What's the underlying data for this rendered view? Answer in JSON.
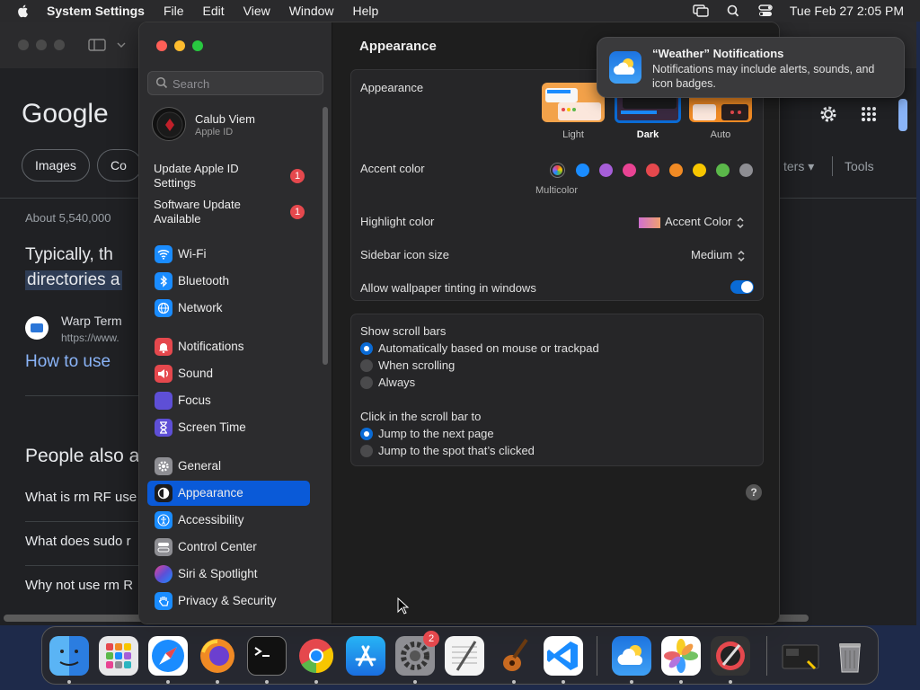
{
  "menubar": {
    "app_name": "System Settings",
    "items": [
      "File",
      "Edit",
      "View",
      "Window",
      "Help"
    ],
    "clock": "Tue Feb 27  2:05 PM"
  },
  "browser": {
    "logo": "Google",
    "chips": [
      "Images",
      "Co"
    ],
    "results_count": "About 5,540,000",
    "snippet_line1": "Typically, th",
    "snippet_line2": "directories a",
    "site_name": "Warp Term",
    "site_url": "https://www.",
    "result_link": "How to use",
    "people_also": "People also a",
    "questions": [
      "What is rm RF use",
      "What does sudo r",
      "Why not use rm R"
    ],
    "filters": "ters",
    "tools": "Tools"
  },
  "sidebar": {
    "search_placeholder": "Search",
    "profile_name": "Calub Viem",
    "profile_sub": "Apple ID",
    "notices": [
      {
        "label": "Update Apple ID Settings",
        "badge": "1"
      },
      {
        "label": "Software Update Available",
        "badge": "1"
      }
    ],
    "items": [
      {
        "label": "Wi-Fi",
        "color": "#1a8cff"
      },
      {
        "label": "Bluetooth",
        "color": "#1a8cff"
      },
      {
        "label": "Network",
        "color": "#1a8cff"
      },
      {
        "label": "Notifications",
        "color": "#e5484d"
      },
      {
        "label": "Sound",
        "color": "#e5484d"
      },
      {
        "label": "Focus",
        "color": "#5e4fd6"
      },
      {
        "label": "Screen Time",
        "color": "#5e4fd6"
      },
      {
        "label": "General",
        "color": "#8e8e93"
      },
      {
        "label": "Appearance",
        "color": "#1c1c1e"
      },
      {
        "label": "Accessibility",
        "color": "#1a8cff"
      },
      {
        "label": "Control Center",
        "color": "#8e8e93"
      },
      {
        "label": "Siri & Spotlight",
        "color": "#b04ad8"
      },
      {
        "label": "Privacy & Security",
        "color": "#1a8cff"
      }
    ]
  },
  "content": {
    "title": "Appearance",
    "appearance_label": "Appearance",
    "modes": [
      "Light",
      "Dark",
      "Auto"
    ],
    "accent_label": "Accent color",
    "accent_colors": [
      "#1a8cff",
      "#a65ed8",
      "#e84393",
      "#e5484d",
      "#f08a24",
      "#f7c600",
      "#5bb84a",
      "#8e8e93"
    ],
    "multicolor_label": "Multicolor",
    "highlight_label": "Highlight color",
    "highlight_value": "Accent Color",
    "sidebar_icon_label": "Sidebar icon size",
    "sidebar_icon_value": "Medium",
    "wallpaper_tint_label": "Allow wallpaper tinting in windows",
    "scrollbars_label": "Show scroll bars",
    "scrollbar_options": [
      "Automatically based on mouse or trackpad",
      "When scrolling",
      "Always"
    ],
    "click_label": "Click in the scroll bar to",
    "click_options": [
      "Jump to the next page",
      "Jump to the spot that’s clicked"
    ],
    "help": "?"
  },
  "notification": {
    "title": "“Weather” Notifications",
    "body": "Notifications may include alerts, sounds, and icon badges."
  },
  "dock": {
    "settings_badge": "2"
  }
}
